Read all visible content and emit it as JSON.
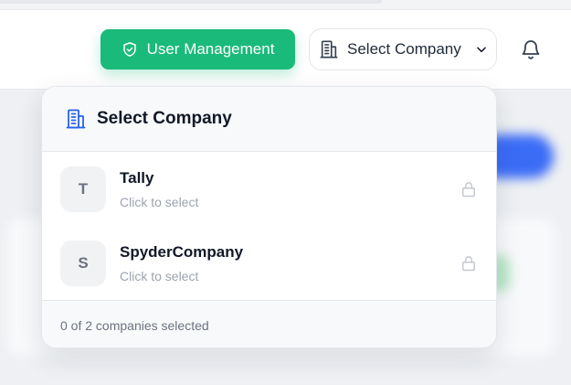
{
  "header": {
    "user_management_label": "User Management",
    "company_select_label": "Select Company"
  },
  "dropdown": {
    "title": "Select Company",
    "companies": [
      {
        "initial": "T",
        "name": "Tally",
        "hint": "Click to select"
      },
      {
        "initial": "S",
        "name": "SpyderCompany",
        "hint": "Click to select"
      }
    ],
    "footer": "0 of 2 companies selected"
  },
  "colors": {
    "accent_green": "#1aba7a",
    "accent_blue": "#2563eb",
    "muted_text": "#9ca3af"
  },
  "icons": {
    "user_management": "shield-check-icon",
    "company": "building-icon",
    "dropdown": "chevron-down-icon",
    "notifications": "bell-icon",
    "company_item": "lock-icon"
  }
}
